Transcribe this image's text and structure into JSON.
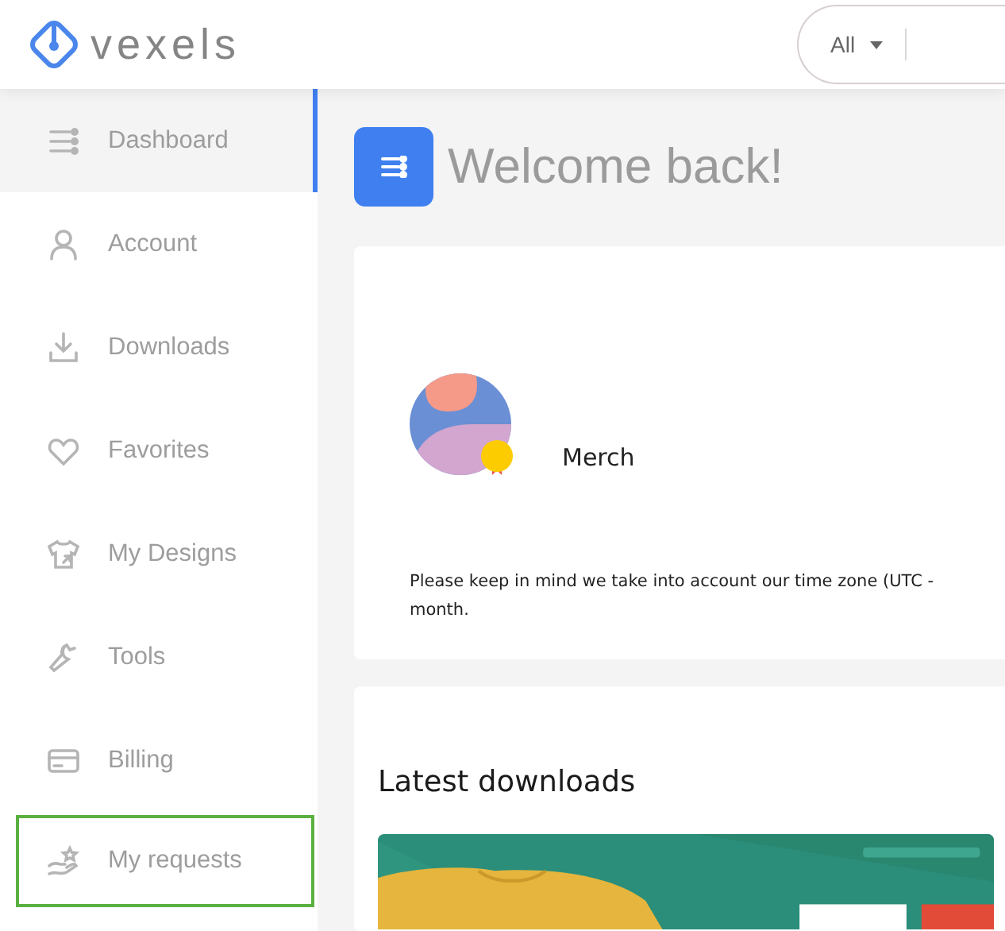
{
  "header": {
    "logo": "vexels",
    "search": {
      "category": "All"
    }
  },
  "sidebar": {
    "items": [
      {
        "label": "Dashboard",
        "kind": "sliders",
        "selected": true,
        "highlighted": false
      },
      {
        "label": "Account",
        "kind": "user",
        "selected": false,
        "highlighted": false
      },
      {
        "label": "Downloads",
        "kind": "download",
        "selected": false,
        "highlighted": false
      },
      {
        "label": "Favorites",
        "kind": "heart",
        "selected": false,
        "highlighted": false
      },
      {
        "label": "My Designs",
        "kind": "shirt",
        "selected": false,
        "highlighted": false
      },
      {
        "label": "Tools",
        "kind": "wrench",
        "selected": false,
        "highlighted": false
      },
      {
        "label": "Billing",
        "kind": "card",
        "selected": false,
        "highlighted": false
      },
      {
        "label": "My requests",
        "kind": "hand",
        "selected": false,
        "highlighted": true
      }
    ]
  },
  "page": {
    "title": "Welcome back!"
  },
  "plan_card": {
    "plan": "Merch",
    "note_lines": [
      "Please keep in mind we take into account our time zone (UTC -",
      "month."
    ]
  },
  "downloads_card": {
    "title": "Latest downloads"
  }
}
